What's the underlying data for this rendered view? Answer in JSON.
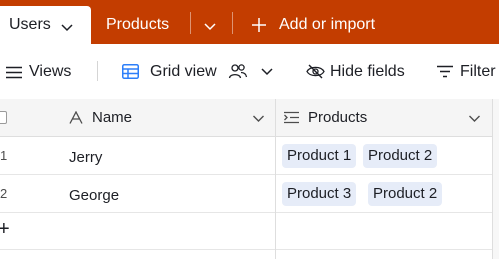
{
  "tabs": {
    "active": {
      "label": "Users"
    },
    "other": {
      "label": "Products"
    },
    "add": {
      "label": "Add or import"
    }
  },
  "toolbar": {
    "views_label": "Views",
    "grid_view_label": "Grid view",
    "hide_fields_label": "Hide fields",
    "filter_label": "Filter"
  },
  "grid": {
    "columns": [
      {
        "label": "Name",
        "icon": "text-type-icon"
      },
      {
        "label": "Products",
        "icon": "linked-records-icon"
      }
    ],
    "rows": [
      {
        "number": "1",
        "name": "Jerry",
        "products": [
          "Product 1",
          "Product 2"
        ]
      },
      {
        "number": "2",
        "name": "George",
        "products": [
          "Product 3",
          "Product 2"
        ]
      }
    ],
    "add_row_symbol": "+"
  },
  "colors": {
    "tab_bar": "#c33d00",
    "chip_bg": "#e6ecf8",
    "grid_icon": "#2d7ff9"
  }
}
